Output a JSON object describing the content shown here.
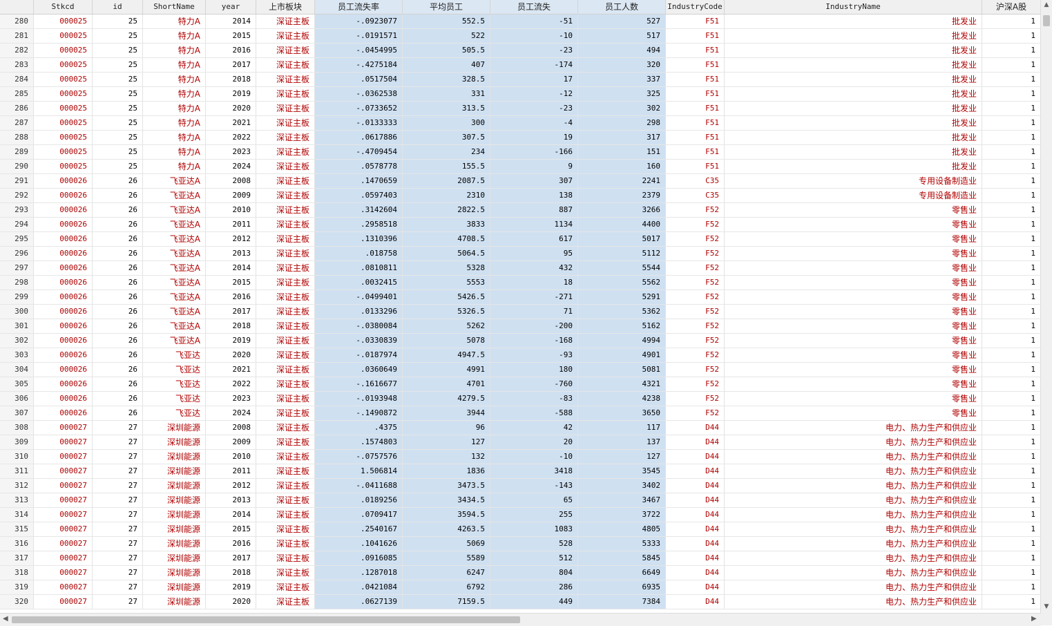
{
  "columns": [
    {
      "key": "obs",
      "label": ""
    },
    {
      "key": "stkcd",
      "label": "Stkcd"
    },
    {
      "key": "id",
      "label": "id"
    },
    {
      "key": "short",
      "label": "ShortName"
    },
    {
      "key": "year",
      "label": "year"
    },
    {
      "key": "board",
      "label": "上市板块"
    },
    {
      "key": "rate",
      "label": "员工流失率"
    },
    {
      "key": "avg",
      "label": "平均员工"
    },
    {
      "key": "loss",
      "label": "员工流失"
    },
    {
      "key": "emp",
      "label": "员工人数"
    },
    {
      "key": "icode",
      "label": "IndustryCode"
    },
    {
      "key": "iname",
      "label": "IndustryName"
    },
    {
      "key": "hs",
      "label": "沪深A股"
    }
  ],
  "rows": [
    [
      "280",
      "000025",
      "25",
      "特力A",
      "2014",
      "深证主板",
      "-.0923077",
      "552.5",
      "-51",
      "527",
      "F51",
      "批发业",
      "1"
    ],
    [
      "281",
      "000025",
      "25",
      "特力A",
      "2015",
      "深证主板",
      "-.0191571",
      "522",
      "-10",
      "517",
      "F51",
      "批发业",
      "1"
    ],
    [
      "282",
      "000025",
      "25",
      "特力A",
      "2016",
      "深证主板",
      "-.0454995",
      "505.5",
      "-23",
      "494",
      "F51",
      "批发业",
      "1"
    ],
    [
      "283",
      "000025",
      "25",
      "特力A",
      "2017",
      "深证主板",
      "-.4275184",
      "407",
      "-174",
      "320",
      "F51",
      "批发业",
      "1"
    ],
    [
      "284",
      "000025",
      "25",
      "特力A",
      "2018",
      "深证主板",
      ".0517504",
      "328.5",
      "17",
      "337",
      "F51",
      "批发业",
      "1"
    ],
    [
      "285",
      "000025",
      "25",
      "特力A",
      "2019",
      "深证主板",
      "-.0362538",
      "331",
      "-12",
      "325",
      "F51",
      "批发业",
      "1"
    ],
    [
      "286",
      "000025",
      "25",
      "特力A",
      "2020",
      "深证主板",
      "-.0733652",
      "313.5",
      "-23",
      "302",
      "F51",
      "批发业",
      "1"
    ],
    [
      "287",
      "000025",
      "25",
      "特力A",
      "2021",
      "深证主板",
      "-.0133333",
      "300",
      "-4",
      "298",
      "F51",
      "批发业",
      "1"
    ],
    [
      "288",
      "000025",
      "25",
      "特力A",
      "2022",
      "深证主板",
      ".0617886",
      "307.5",
      "19",
      "317",
      "F51",
      "批发业",
      "1"
    ],
    [
      "289",
      "000025",
      "25",
      "特力A",
      "2023",
      "深证主板",
      "-.4709454",
      "234",
      "-166",
      "151",
      "F51",
      "批发业",
      "1"
    ],
    [
      "290",
      "000025",
      "25",
      "特力A",
      "2024",
      "深证主板",
      ".0578778",
      "155.5",
      "9",
      "160",
      "F51",
      "批发业",
      "1"
    ],
    [
      "291",
      "000026",
      "26",
      "飞亚达A",
      "2008",
      "深证主板",
      ".1470659",
      "2087.5",
      "307",
      "2241",
      "C35",
      "专用设备制造业",
      "1"
    ],
    [
      "292",
      "000026",
      "26",
      "飞亚达A",
      "2009",
      "深证主板",
      ".0597403",
      "2310",
      "138",
      "2379",
      "C35",
      "专用设备制造业",
      "1"
    ],
    [
      "293",
      "000026",
      "26",
      "飞亚达A",
      "2010",
      "深证主板",
      ".3142604",
      "2822.5",
      "887",
      "3266",
      "F52",
      "零售业",
      "1"
    ],
    [
      "294",
      "000026",
      "26",
      "飞亚达A",
      "2011",
      "深证主板",
      ".2958518",
      "3833",
      "1134",
      "4400",
      "F52",
      "零售业",
      "1"
    ],
    [
      "295",
      "000026",
      "26",
      "飞亚达A",
      "2012",
      "深证主板",
      ".1310396",
      "4708.5",
      "617",
      "5017",
      "F52",
      "零售业",
      "1"
    ],
    [
      "296",
      "000026",
      "26",
      "飞亚达A",
      "2013",
      "深证主板",
      ".018758",
      "5064.5",
      "95",
      "5112",
      "F52",
      "零售业",
      "1"
    ],
    [
      "297",
      "000026",
      "26",
      "飞亚达A",
      "2014",
      "深证主板",
      ".0810811",
      "5328",
      "432",
      "5544",
      "F52",
      "零售业",
      "1"
    ],
    [
      "298",
      "000026",
      "26",
      "飞亚达A",
      "2015",
      "深证主板",
      ".0032415",
      "5553",
      "18",
      "5562",
      "F52",
      "零售业",
      "1"
    ],
    [
      "299",
      "000026",
      "26",
      "飞亚达A",
      "2016",
      "深证主板",
      "-.0499401",
      "5426.5",
      "-271",
      "5291",
      "F52",
      "零售业",
      "1"
    ],
    [
      "300",
      "000026",
      "26",
      "飞亚达A",
      "2017",
      "深证主板",
      ".0133296",
      "5326.5",
      "71",
      "5362",
      "F52",
      "零售业",
      "1"
    ],
    [
      "301",
      "000026",
      "26",
      "飞亚达A",
      "2018",
      "深证主板",
      "-.0380084",
      "5262",
      "-200",
      "5162",
      "F52",
      "零售业",
      "1"
    ],
    [
      "302",
      "000026",
      "26",
      "飞亚达A",
      "2019",
      "深证主板",
      "-.0330839",
      "5078",
      "-168",
      "4994",
      "F52",
      "零售业",
      "1"
    ],
    [
      "303",
      "000026",
      "26",
      "飞亚达",
      "2020",
      "深证主板",
      "-.0187974",
      "4947.5",
      "-93",
      "4901",
      "F52",
      "零售业",
      "1"
    ],
    [
      "304",
      "000026",
      "26",
      "飞亚达",
      "2021",
      "深证主板",
      ".0360649",
      "4991",
      "180",
      "5081",
      "F52",
      "零售业",
      "1"
    ],
    [
      "305",
      "000026",
      "26",
      "飞亚达",
      "2022",
      "深证主板",
      "-.1616677",
      "4701",
      "-760",
      "4321",
      "F52",
      "零售业",
      "1"
    ],
    [
      "306",
      "000026",
      "26",
      "飞亚达",
      "2023",
      "深证主板",
      "-.0193948",
      "4279.5",
      "-83",
      "4238",
      "F52",
      "零售业",
      "1"
    ],
    [
      "307",
      "000026",
      "26",
      "飞亚达",
      "2024",
      "深证主板",
      "-.1490872",
      "3944",
      "-588",
      "3650",
      "F52",
      "零售业",
      "1"
    ],
    [
      "308",
      "000027",
      "27",
      "深圳能源",
      "2008",
      "深证主板",
      ".4375",
      "96",
      "42",
      "117",
      "D44",
      "电力、热力生产和供应业",
      "1"
    ],
    [
      "309",
      "000027",
      "27",
      "深圳能源",
      "2009",
      "深证主板",
      ".1574803",
      "127",
      "20",
      "137",
      "D44",
      "电力、热力生产和供应业",
      "1"
    ],
    [
      "310",
      "000027",
      "27",
      "深圳能源",
      "2010",
      "深证主板",
      "-.0757576",
      "132",
      "-10",
      "127",
      "D44",
      "电力、热力生产和供应业",
      "1"
    ],
    [
      "311",
      "000027",
      "27",
      "深圳能源",
      "2011",
      "深证主板",
      "1.506814",
      "1836",
      "3418",
      "3545",
      "D44",
      "电力、热力生产和供应业",
      "1"
    ],
    [
      "312",
      "000027",
      "27",
      "深圳能源",
      "2012",
      "深证主板",
      "-.0411688",
      "3473.5",
      "-143",
      "3402",
      "D44",
      "电力、热力生产和供应业",
      "1"
    ],
    [
      "313",
      "000027",
      "27",
      "深圳能源",
      "2013",
      "深证主板",
      ".0189256",
      "3434.5",
      "65",
      "3467",
      "D44",
      "电力、热力生产和供应业",
      "1"
    ],
    [
      "314",
      "000027",
      "27",
      "深圳能源",
      "2014",
      "深证主板",
      ".0709417",
      "3594.5",
      "255",
      "3722",
      "D44",
      "电力、热力生产和供应业",
      "1"
    ],
    [
      "315",
      "000027",
      "27",
      "深圳能源",
      "2015",
      "深证主板",
      ".2540167",
      "4263.5",
      "1083",
      "4805",
      "D44",
      "电力、热力生产和供应业",
      "1"
    ],
    [
      "316",
      "000027",
      "27",
      "深圳能源",
      "2016",
      "深证主板",
      ".1041626",
      "5069",
      "528",
      "5333",
      "D44",
      "电力、热力生产和供应业",
      "1"
    ],
    [
      "317",
      "000027",
      "27",
      "深圳能源",
      "2017",
      "深证主板",
      ".0916085",
      "5589",
      "512",
      "5845",
      "D44",
      "电力、热力生产和供应业",
      "1"
    ],
    [
      "318",
      "000027",
      "27",
      "深圳能源",
      "2018",
      "深证主板",
      ".1287018",
      "6247",
      "804",
      "6649",
      "D44",
      "电力、热力生产和供应业",
      "1"
    ],
    [
      "319",
      "000027",
      "27",
      "深圳能源",
      "2019",
      "深证主板",
      ".0421084",
      "6792",
      "286",
      "6935",
      "D44",
      "电力、热力生产和供应业",
      "1"
    ],
    [
      "320",
      "000027",
      "27",
      "深圳能源",
      "2020",
      "深证主板",
      ".0627139",
      "7159.5",
      "449",
      "7384",
      "D44",
      "电力、热力生产和供应业",
      "1"
    ]
  ],
  "colors": {
    "string_text": "#b00000",
    "selected_bg": "#cfe0f1",
    "header_bg": "#f0f0f0"
  },
  "icons": {
    "scroll_up": "scroll-up-arrow-icon",
    "scroll_down": "scroll-down-arrow-icon",
    "scroll_left": "scroll-left-arrow-icon",
    "scroll_right": "scroll-right-arrow-icon"
  }
}
